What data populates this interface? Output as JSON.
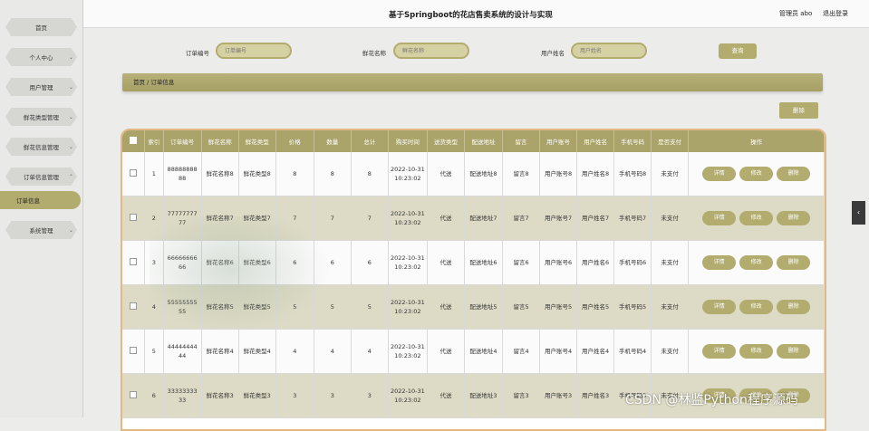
{
  "header": {
    "title": "基于Springboot的花店售卖系统的设计与实现",
    "admin": "管理员 abo",
    "logout": "退出登录"
  },
  "sidebar": {
    "items": [
      {
        "label": "首页",
        "chevron": ""
      },
      {
        "label": "个人中心",
        "chevron": "⌄"
      },
      {
        "label": "用户管理",
        "chevron": "⌄"
      },
      {
        "label": "鲜花类型管理",
        "chevron": "⌄"
      },
      {
        "label": "鲜花信息管理",
        "chevron": "⌄"
      },
      {
        "label": "订单信息管理",
        "chevron": "⌃"
      },
      {
        "label": "订单信息",
        "chevron": ""
      },
      {
        "label": "系统管理",
        "chevron": "⌄"
      }
    ]
  },
  "search": {
    "order_no_label": "订单编号",
    "order_no_placeholder": "订单编号",
    "flower_name_label": "鲜花名称",
    "flower_name_placeholder": "鲜花名称",
    "user_name_label": "用户姓名",
    "user_name_placeholder": "用户姓名",
    "query_button": "查询"
  },
  "breadcrumb": "首页 / 订单信息",
  "delete_button": "删除",
  "table": {
    "headers": [
      "索引",
      "订单编号",
      "鲜花名称",
      "鲜花类型",
      "价格",
      "数量",
      "总计",
      "购买时间",
      "送货类型",
      "配送地址",
      "留言",
      "用户账号",
      "用户姓名",
      "手机号码",
      "是否支付",
      "操作"
    ],
    "rows": [
      [
        "1",
        "8888888888",
        "鲜花名称8",
        "鲜花类型8",
        "8",
        "8",
        "8",
        "2022-10-31 10:23:02",
        "代送",
        "配送地址8",
        "留言8",
        "用户账号8",
        "用户姓名8",
        "手机号码8",
        "未支付"
      ],
      [
        "2",
        "7777777777",
        "鲜花名称7",
        "鲜花类型7",
        "7",
        "7",
        "7",
        "2022-10-31 10:23:02",
        "代送",
        "配送地址7",
        "留言7",
        "用户账号7",
        "用户姓名7",
        "手机号码7",
        "未支付"
      ],
      [
        "3",
        "6666666666",
        "鲜花名称6",
        "鲜花类型6",
        "6",
        "6",
        "6",
        "2022-10-31 10:23:02",
        "代送",
        "配送地址6",
        "留言6",
        "用户账号6",
        "用户姓名6",
        "手机号码6",
        "未支付"
      ],
      [
        "4",
        "5555555555",
        "鲜花名称5",
        "鲜花类型5",
        "5",
        "5",
        "5",
        "2022-10-31 10:23:02",
        "代送",
        "配送地址5",
        "留言5",
        "用户账号5",
        "用户姓名5",
        "手机号码5",
        "未支付"
      ],
      [
        "5",
        "4444444444",
        "鲜花名称4",
        "鲜花类型4",
        "4",
        "4",
        "4",
        "2022-10-31 10:23:02",
        "代送",
        "配送地址4",
        "留言4",
        "用户账号4",
        "用户姓名4",
        "手机号码4",
        "未支付"
      ],
      [
        "6",
        "3333333333",
        "鲜花名称3",
        "鲜花类型3",
        "3",
        "3",
        "3",
        "2022-10-31 10:23:02",
        "代送",
        "配送地址3",
        "留言3",
        "用户账号3",
        "用户姓名3",
        "手机号码3",
        "未支付"
      ]
    ],
    "actions": {
      "detail": "详情",
      "edit": "修改",
      "delete": "删除"
    }
  },
  "side_tab_icon": "chevron-left-icon",
  "side_tab_glyph": "‹",
  "watermark_text": "CSDN @林监Python程序源码",
  "colors": {
    "accent": "#b3ac6f",
    "header_row": "#aaa36a",
    "alt_row": "#dddbc5",
    "table_border": "#e3b885"
  }
}
